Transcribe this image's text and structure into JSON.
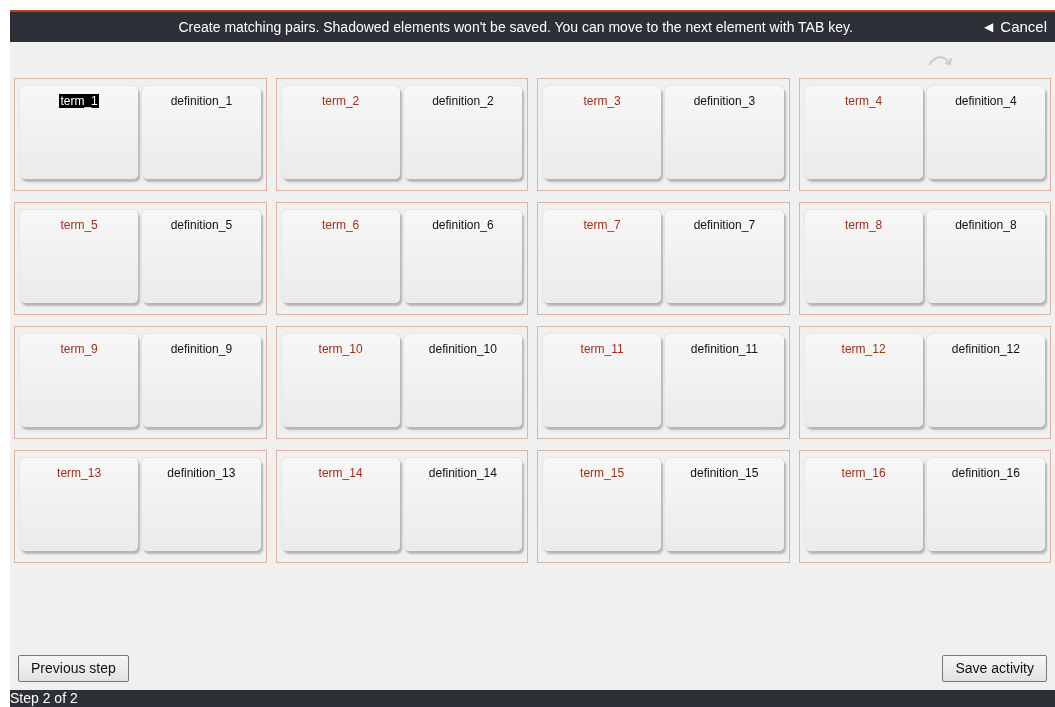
{
  "header": {
    "instruction": "Create matching pairs. Shadowed elements won't be saved. You can move to the next element with TAB key.",
    "cancel": "◄ Cancel"
  },
  "pairs": [
    {
      "term": "term_1",
      "definition": "definition_1",
      "selected": true
    },
    {
      "term": "term_2",
      "definition": "definition_2",
      "selected": false
    },
    {
      "term": "term_3",
      "definition": "definition_3",
      "selected": false
    },
    {
      "term": "term_4",
      "definition": "definition_4",
      "selected": false
    },
    {
      "term": "term_5",
      "definition": "definition_5",
      "selected": false
    },
    {
      "term": "term_6",
      "definition": "definition_6",
      "selected": false
    },
    {
      "term": "term_7",
      "definition": "definition_7",
      "selected": false
    },
    {
      "term": "term_8",
      "definition": "definition_8",
      "selected": false
    },
    {
      "term": "term_9",
      "definition": "definition_9",
      "selected": false
    },
    {
      "term": "term_10",
      "definition": "definition_10",
      "selected": false
    },
    {
      "term": "term_11",
      "definition": "definition_11",
      "selected": false
    },
    {
      "term": "term_12",
      "definition": "definition_12",
      "selected": false
    },
    {
      "term": "term_13",
      "definition": "definition_13",
      "selected": false
    },
    {
      "term": "term_14",
      "definition": "definition_14",
      "selected": false
    },
    {
      "term": "term_15",
      "definition": "definition_15",
      "selected": false
    },
    {
      "term": "term_16",
      "definition": "definition_16",
      "selected": false
    }
  ],
  "buttons": {
    "previous": "Previous step",
    "save": "Save activity"
  },
  "status_bar": "Step 2 of 2"
}
